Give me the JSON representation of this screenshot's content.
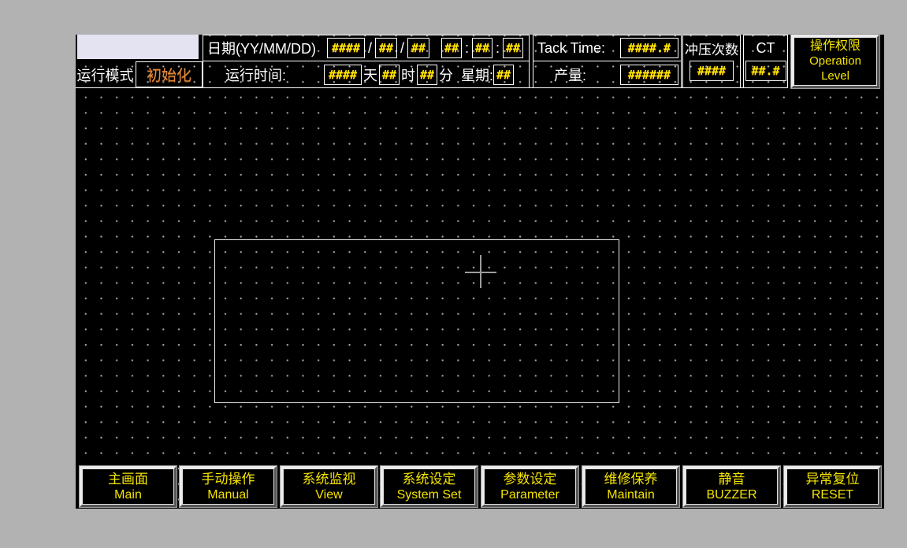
{
  "colors": {
    "desktop_gray": "#b2b2b2",
    "screen_black": "#000000",
    "value_yellow": "#ffe800",
    "button_text_yellow": "#f5e400",
    "label_white": "#ffffff",
    "mode_orange": "#e08a3a",
    "status_box_lavender": "#e3e3f2",
    "border_white": "#ffffff",
    "crosshair_gray": "#9c9c9c"
  },
  "header": {
    "mode_label": "运行模式",
    "mode_value": "初始化",
    "date_label": "日期(YY/MM/DD)",
    "date_year": "####",
    "date_sep": "/",
    "date_month": "##",
    "date_day": "##",
    "time_hh": "##",
    "time_colon": ":",
    "time_mm": "##",
    "time_ss": "##",
    "runtime_label": "运行时间:",
    "runtime_days": "####",
    "unit_day": "天",
    "runtime_hours": "##",
    "unit_hour": "时",
    "runtime_minutes": "##",
    "unit_minute": "分",
    "weekday_label": "星期:",
    "weekday_value": "##",
    "tack_time_label": "Tack Time:",
    "tack_time_value": "####.#",
    "yield_label": "产量:",
    "yield_value": "######",
    "press_count_label": "冲压次数",
    "press_count_value": "####",
    "ct_label": "CT",
    "ct_value": "##.#",
    "operation_level": {
      "zh": "操作权限",
      "en1": "Operation",
      "en2": "Level"
    }
  },
  "nav_buttons": [
    {
      "id": "main",
      "zh": "主画面",
      "en": "Main"
    },
    {
      "id": "manual",
      "zh": "手动操作",
      "en": "Manual"
    },
    {
      "id": "view",
      "zh": "系统监视",
      "en": "View"
    },
    {
      "id": "system-set",
      "zh": "系统设定",
      "en": "System Set"
    },
    {
      "id": "parameter",
      "zh": "参数设定",
      "en": "Parameter"
    },
    {
      "id": "maintain",
      "zh": "维修保养",
      "en": "Maintain"
    },
    {
      "id": "buzzer",
      "zh": "静音",
      "en": "BUZZER"
    },
    {
      "id": "reset",
      "zh": "异常复位",
      "en": "RESET"
    }
  ]
}
